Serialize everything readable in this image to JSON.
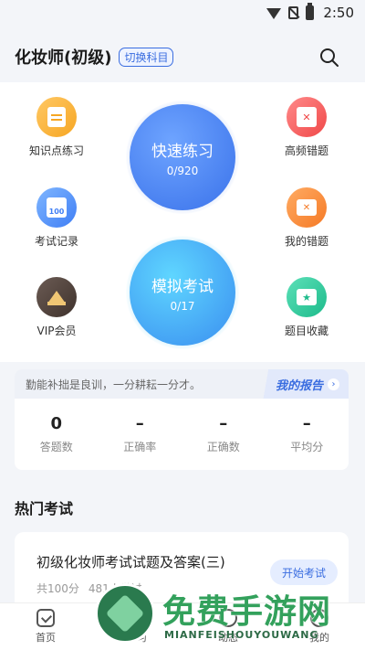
{
  "status_bar": {
    "time": "2:50"
  },
  "header": {
    "title": "化妆师(初级)",
    "switch_label": "切换科目"
  },
  "features": {
    "knowledge": "知识点练习",
    "record": "考试记录",
    "vip": "VIP会员",
    "hot_errors": "高频错题",
    "my_errors": "我的错题",
    "favorites": "题目收藏"
  },
  "quick_practice": {
    "title": "快速练习",
    "progress": "0/920"
  },
  "mock_exam": {
    "title": "模拟考试",
    "progress": "0/17"
  },
  "report": {
    "motto": "勤能补拙是良训，一分耕耘一分才。",
    "link_label": "我的报告",
    "stats": [
      {
        "value": "0",
        "label": "答题数"
      },
      {
        "value": "–",
        "label": "正确率"
      },
      {
        "value": "–",
        "label": "正确数"
      },
      {
        "value": "–",
        "label": "平均分"
      }
    ]
  },
  "hot_section": {
    "title": "热门考试"
  },
  "exam": {
    "title": "初级化妆师考试试题及答案(三)",
    "total": "共100分",
    "participants": "481人做过",
    "start_label": "开始考试"
  },
  "nav": [
    "首页",
    "学习",
    "动态",
    "我的"
  ],
  "watermark": {
    "title": "免费手游网",
    "subtitle": "MIANFEISHOUYOUWANG"
  },
  "colors": {
    "accent": "#3a6de0",
    "background": "#f3f5f9"
  }
}
